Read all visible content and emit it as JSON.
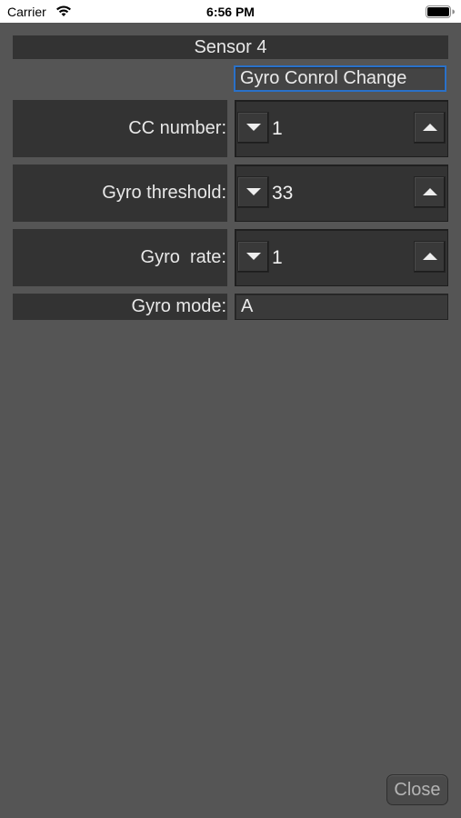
{
  "status_bar": {
    "carrier": "Carrier",
    "time": "6:56 PM",
    "icons": [
      "wifi-icon",
      "battery-icon"
    ]
  },
  "sensor_title": "Sensor 4",
  "mode_field": {
    "value": "Gyro Conrol Change",
    "focus_color": "#2a71c9"
  },
  "rows": [
    {
      "label": "CC number:",
      "value": "1"
    },
    {
      "label": "Gyro threshold:",
      "value": "33"
    },
    {
      "label": "Gyro  rate:",
      "value": "1"
    }
  ],
  "gyro_mode": {
    "label": "Gyro mode:",
    "value": "A"
  },
  "close_label": "Close",
  "colors": {
    "background": "#555555",
    "panel": "#333333",
    "text": "#e8e8e8"
  }
}
